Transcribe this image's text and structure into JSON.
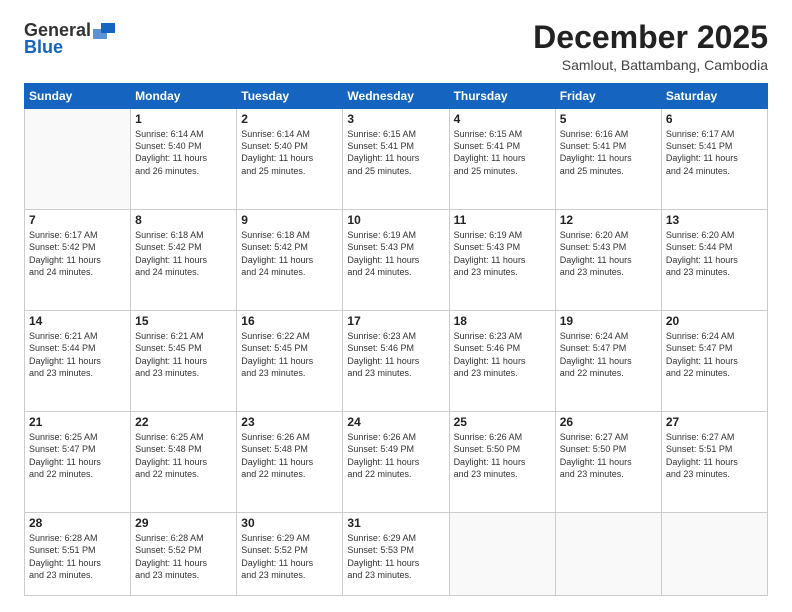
{
  "logo": {
    "general": "General",
    "blue": "Blue"
  },
  "header": {
    "month": "December 2025",
    "location": "Samlout, Battambang, Cambodia"
  },
  "days": [
    "Sunday",
    "Monday",
    "Tuesday",
    "Wednesday",
    "Thursday",
    "Friday",
    "Saturday"
  ],
  "weeks": [
    [
      {
        "num": "",
        "lines": []
      },
      {
        "num": "1",
        "lines": [
          "Sunrise: 6:14 AM",
          "Sunset: 5:40 PM",
          "Daylight: 11 hours",
          "and 26 minutes."
        ]
      },
      {
        "num": "2",
        "lines": [
          "Sunrise: 6:14 AM",
          "Sunset: 5:40 PM",
          "Daylight: 11 hours",
          "and 25 minutes."
        ]
      },
      {
        "num": "3",
        "lines": [
          "Sunrise: 6:15 AM",
          "Sunset: 5:41 PM",
          "Daylight: 11 hours",
          "and 25 minutes."
        ]
      },
      {
        "num": "4",
        "lines": [
          "Sunrise: 6:15 AM",
          "Sunset: 5:41 PM",
          "Daylight: 11 hours",
          "and 25 minutes."
        ]
      },
      {
        "num": "5",
        "lines": [
          "Sunrise: 6:16 AM",
          "Sunset: 5:41 PM",
          "Daylight: 11 hours",
          "and 25 minutes."
        ]
      },
      {
        "num": "6",
        "lines": [
          "Sunrise: 6:17 AM",
          "Sunset: 5:41 PM",
          "Daylight: 11 hours",
          "and 24 minutes."
        ]
      }
    ],
    [
      {
        "num": "7",
        "lines": [
          "Sunrise: 6:17 AM",
          "Sunset: 5:42 PM",
          "Daylight: 11 hours",
          "and 24 minutes."
        ]
      },
      {
        "num": "8",
        "lines": [
          "Sunrise: 6:18 AM",
          "Sunset: 5:42 PM",
          "Daylight: 11 hours",
          "and 24 minutes."
        ]
      },
      {
        "num": "9",
        "lines": [
          "Sunrise: 6:18 AM",
          "Sunset: 5:42 PM",
          "Daylight: 11 hours",
          "and 24 minutes."
        ]
      },
      {
        "num": "10",
        "lines": [
          "Sunrise: 6:19 AM",
          "Sunset: 5:43 PM",
          "Daylight: 11 hours",
          "and 24 minutes."
        ]
      },
      {
        "num": "11",
        "lines": [
          "Sunrise: 6:19 AM",
          "Sunset: 5:43 PM",
          "Daylight: 11 hours",
          "and 23 minutes."
        ]
      },
      {
        "num": "12",
        "lines": [
          "Sunrise: 6:20 AM",
          "Sunset: 5:43 PM",
          "Daylight: 11 hours",
          "and 23 minutes."
        ]
      },
      {
        "num": "13",
        "lines": [
          "Sunrise: 6:20 AM",
          "Sunset: 5:44 PM",
          "Daylight: 11 hours",
          "and 23 minutes."
        ]
      }
    ],
    [
      {
        "num": "14",
        "lines": [
          "Sunrise: 6:21 AM",
          "Sunset: 5:44 PM",
          "Daylight: 11 hours",
          "and 23 minutes."
        ]
      },
      {
        "num": "15",
        "lines": [
          "Sunrise: 6:21 AM",
          "Sunset: 5:45 PM",
          "Daylight: 11 hours",
          "and 23 minutes."
        ]
      },
      {
        "num": "16",
        "lines": [
          "Sunrise: 6:22 AM",
          "Sunset: 5:45 PM",
          "Daylight: 11 hours",
          "and 23 minutes."
        ]
      },
      {
        "num": "17",
        "lines": [
          "Sunrise: 6:23 AM",
          "Sunset: 5:46 PM",
          "Daylight: 11 hours",
          "and 23 minutes."
        ]
      },
      {
        "num": "18",
        "lines": [
          "Sunrise: 6:23 AM",
          "Sunset: 5:46 PM",
          "Daylight: 11 hours",
          "and 23 minutes."
        ]
      },
      {
        "num": "19",
        "lines": [
          "Sunrise: 6:24 AM",
          "Sunset: 5:47 PM",
          "Daylight: 11 hours",
          "and 22 minutes."
        ]
      },
      {
        "num": "20",
        "lines": [
          "Sunrise: 6:24 AM",
          "Sunset: 5:47 PM",
          "Daylight: 11 hours",
          "and 22 minutes."
        ]
      }
    ],
    [
      {
        "num": "21",
        "lines": [
          "Sunrise: 6:25 AM",
          "Sunset: 5:47 PM",
          "Daylight: 11 hours",
          "and 22 minutes."
        ]
      },
      {
        "num": "22",
        "lines": [
          "Sunrise: 6:25 AM",
          "Sunset: 5:48 PM",
          "Daylight: 11 hours",
          "and 22 minutes."
        ]
      },
      {
        "num": "23",
        "lines": [
          "Sunrise: 6:26 AM",
          "Sunset: 5:48 PM",
          "Daylight: 11 hours",
          "and 22 minutes."
        ]
      },
      {
        "num": "24",
        "lines": [
          "Sunrise: 6:26 AM",
          "Sunset: 5:49 PM",
          "Daylight: 11 hours",
          "and 22 minutes."
        ]
      },
      {
        "num": "25",
        "lines": [
          "Sunrise: 6:26 AM",
          "Sunset: 5:50 PM",
          "Daylight: 11 hours",
          "and 23 minutes."
        ]
      },
      {
        "num": "26",
        "lines": [
          "Sunrise: 6:27 AM",
          "Sunset: 5:50 PM",
          "Daylight: 11 hours",
          "and 23 minutes."
        ]
      },
      {
        "num": "27",
        "lines": [
          "Sunrise: 6:27 AM",
          "Sunset: 5:51 PM",
          "Daylight: 11 hours",
          "and 23 minutes."
        ]
      }
    ],
    [
      {
        "num": "28",
        "lines": [
          "Sunrise: 6:28 AM",
          "Sunset: 5:51 PM",
          "Daylight: 11 hours",
          "and 23 minutes."
        ]
      },
      {
        "num": "29",
        "lines": [
          "Sunrise: 6:28 AM",
          "Sunset: 5:52 PM",
          "Daylight: 11 hours",
          "and 23 minutes."
        ]
      },
      {
        "num": "30",
        "lines": [
          "Sunrise: 6:29 AM",
          "Sunset: 5:52 PM",
          "Daylight: 11 hours",
          "and 23 minutes."
        ]
      },
      {
        "num": "31",
        "lines": [
          "Sunrise: 6:29 AM",
          "Sunset: 5:53 PM",
          "Daylight: 11 hours",
          "and 23 minutes."
        ]
      },
      {
        "num": "",
        "lines": []
      },
      {
        "num": "",
        "lines": []
      },
      {
        "num": "",
        "lines": []
      }
    ]
  ]
}
